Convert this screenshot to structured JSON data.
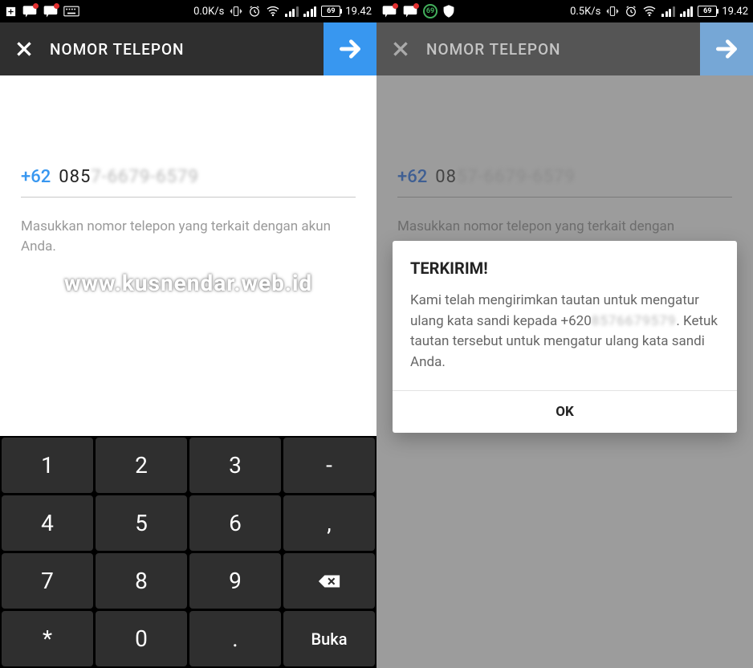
{
  "watermark": "www.kusnendar.web.id",
  "left": {
    "status": {
      "speed": "0.0K/s",
      "time": "19.42",
      "battery_pct": "69"
    },
    "header": {
      "title": "NOMOR TELEPON"
    },
    "form": {
      "country_code": "+62",
      "number_visible": "085",
      "number_hidden": "7-6679-6579",
      "hint": "Masukkan nomor telepon yang terkait dengan akun Anda."
    },
    "keypad": {
      "k1": "1",
      "k2": "2",
      "k3": "3",
      "kd": "-",
      "k4": "4",
      "k5": "5",
      "k6": "6",
      "kc": ",",
      "k7": "7",
      "k8": "8",
      "k9": "9",
      "ks": "*",
      "k0": "0",
      "kp": ".",
      "go": "Buka"
    }
  },
  "right": {
    "status": {
      "speed": "0.5K/s",
      "time": "19.42",
      "battery_pct": "69"
    },
    "header": {
      "title": "NOMOR TELEPON"
    },
    "form": {
      "country_code": "+62",
      "number_visible": "08",
      "number_hidden": "57-6679-6579",
      "hint": "Masukkan nomor telepon yang terkait dengan"
    },
    "dialog": {
      "title": "TERKIRIM!",
      "body_before": "Kami telah mengirimkan tautan untuk mengatur ulang kata sandi kepada +620",
      "body_hidden": "8576679579",
      "body_after": ". Ketuk tautan tersebut untuk mengatur ulang kata sandi Anda.",
      "ok": "OK"
    }
  }
}
